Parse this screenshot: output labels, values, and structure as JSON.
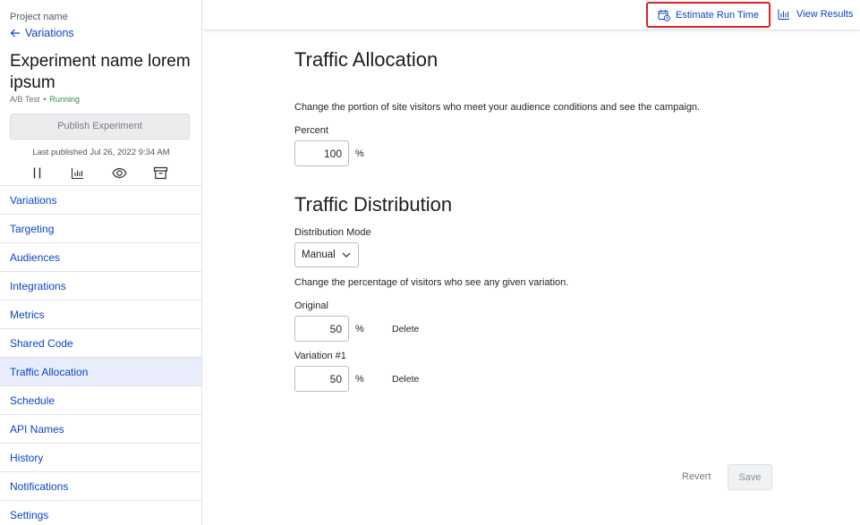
{
  "sidebar": {
    "project_name": "Project name",
    "back_link": "Variations",
    "experiment_title": "Experiment name lorem ipsum",
    "experiment_type": "A/B Test",
    "status_dot": "•",
    "status": "Running",
    "publish_label": "Publish Experiment",
    "last_published": "Last published Jul 26, 2022 9:34 AM",
    "icons": [
      "pause-icon",
      "chart-icon",
      "eye-icon",
      "archive-icon"
    ],
    "items": [
      {
        "label": "Variations"
      },
      {
        "label": "Targeting"
      },
      {
        "label": "Audiences"
      },
      {
        "label": "Integrations"
      },
      {
        "label": "Metrics"
      },
      {
        "label": "Shared Code"
      },
      {
        "label": "Traffic Allocation",
        "active": true
      },
      {
        "label": "Schedule"
      },
      {
        "label": "API Names"
      },
      {
        "label": "History"
      },
      {
        "label": "Notifications"
      },
      {
        "label": "Settings"
      }
    ]
  },
  "topbar": {
    "estimate_label": "Estimate Run Time",
    "results_label": "View Results"
  },
  "main": {
    "allocation_title": "Traffic Allocation",
    "allocation_desc": "Change the portion of site visitors who meet your audience conditions and see the campaign.",
    "percent_label": "Percent",
    "percent_value": "100",
    "percent_unit": "%",
    "distribution_title": "Traffic Distribution",
    "mode_label": "Distribution Mode",
    "mode_value": "Manual",
    "distribution_desc": "Change the percentage of visitors who see any given variation.",
    "variations": [
      {
        "name": "Original",
        "value": "50",
        "unit": "%",
        "delete_label": "Delete"
      },
      {
        "name": "Variation #1",
        "value": "50",
        "unit": "%",
        "delete_label": "Delete"
      }
    ],
    "revert_label": "Revert",
    "save_label": "Save"
  },
  "colors": {
    "link": "#0b45c6",
    "highlight_border": "#d6232a",
    "active_nav_bg": "#e9edfb",
    "running": "#2f8f3e"
  }
}
